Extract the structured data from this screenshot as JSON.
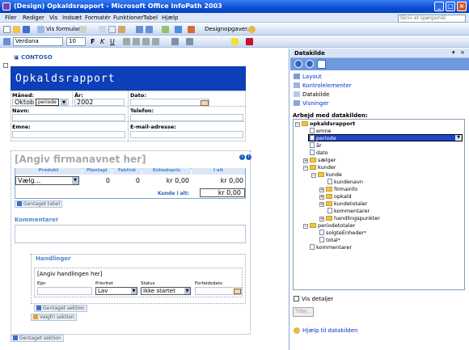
{
  "window": {
    "title": "(Design) Opkaldsrapport - Microsoft Office InfoPath 2003"
  },
  "menu": {
    "items": [
      "Filer",
      "Rediger",
      "Vis",
      "Indsæt",
      "Formatér",
      "Funktioner",
      "Tabel",
      "Hjælp"
    ],
    "help_placeholder": "Skriv et spørgsmål"
  },
  "toolbar": {
    "preview_label": "Vis formular",
    "design_label": "Designopgaver...",
    "font": "Verdana",
    "size": "10"
  },
  "form": {
    "logo": "CONTOSO",
    "banner": "Opkaldsrapport",
    "labels": {
      "month": "Måned:",
      "year": "År:",
      "date": "Dato:",
      "name": "Navn:",
      "phone": "Telefon:",
      "subject": "Emne:",
      "email": "E-mail-adresse:"
    },
    "month_value": "Oktob",
    "period_tag": "periode",
    "year_value": "2002",
    "company_heading": "[Angiv firmanavnet her]",
    "table_headers": [
      "Produkt",
      "Planlagt",
      "Faktisk",
      "Enhedspris",
      "I alt"
    ],
    "table_row": {
      "product": "Vælg...",
      "planned": "0",
      "actual": "0",
      "unit_price": "kr 0,00",
      "total": "kr 0,00"
    },
    "customer_total_label": "Kunde i alt:",
    "customer_total_value": "kr 0,00",
    "repeat_table_tag": "Gentaget tabel",
    "comments_heading": "Kommentarer",
    "actions_heading": "Handlinger",
    "action_placeholder": "[Angiv handlingen her]",
    "action_headers": [
      "Ejer",
      "Prioritet",
      "Status",
      "Forfaldsdato"
    ],
    "action_priority": "Lav",
    "action_status": "Ikke startet",
    "repeat_section_tag": "Gentaget sektion",
    "optional_section_tag": "Valgfri sektion",
    "repeat_section_tag2": "Gentaget sektion"
  },
  "panel": {
    "title": "Datakilde",
    "links": [
      "Layout",
      "Kontrolelementer",
      "Datakilde",
      "Visninger"
    ],
    "tree_caption": "Arbejd med datakilden:",
    "tree": [
      "opkaldsrapport",
      "emne",
      "periode",
      "år",
      "dato",
      "sælger",
      "kunder",
      "kunde",
      "kundenavn",
      "firmainfo",
      "opkald",
      "kundetotaler",
      "kommentarer",
      "handlingspunkter",
      "periodetotaler",
      "solgteEnheder",
      "total",
      "kommentarer"
    ],
    "show_details": "Vis detaljer",
    "add_button": "Tilføj...",
    "help_link": "Hjælp til datakilden"
  }
}
